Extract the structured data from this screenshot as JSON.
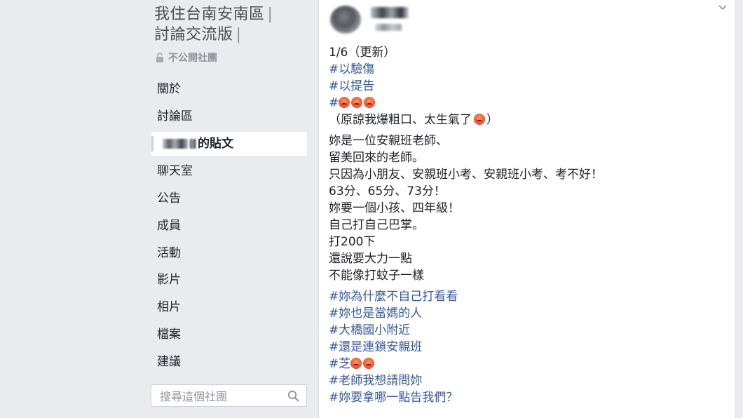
{
  "group": {
    "title_line1": "我住台南安南區",
    "title_line2": "討論交流版",
    "separator": "|",
    "privacy": "不公開社團"
  },
  "nav": {
    "items": [
      {
        "label": "關於"
      },
      {
        "label": "討論區"
      },
      {
        "label": "的貼文",
        "active": true
      },
      {
        "label": "聊天室"
      },
      {
        "label": "公告"
      },
      {
        "label": "成員"
      },
      {
        "label": "活動"
      },
      {
        "label": "影片"
      },
      {
        "label": "相片"
      },
      {
        "label": "檔案"
      },
      {
        "label": "建議"
      }
    ]
  },
  "search": {
    "placeholder": "搜尋這個社團"
  },
  "post": {
    "update_line": "1/6（更新）",
    "tags_top": [
      "#以驗傷",
      "#以提告"
    ],
    "emoji_tag_prefix": "#",
    "apology": "（原諒我爆粗口、太生氣了",
    "apology_end": "）",
    "body_lines": [
      "妳是一位安親班老師、",
      "留美回來的老師。",
      "只因為小朋友、安親班小考、安親班小考、考不好！",
      "63分、65分、73分！",
      "妳要一個小孩、四年級！",
      "自己打自己巴掌。",
      "打200下",
      "還說要大力一點",
      "不能像打蚊子一樣"
    ],
    "tags_bottom": [
      "#妳為什麼不自己打看看",
      "#妳也是當媽的人",
      "#大橋國小附近",
      "#還是連鎖安親班"
    ],
    "tag_zhi": "#芝",
    "tags_final": [
      "#老師我想請問妳",
      "#妳要拿哪一點告我們？"
    ]
  },
  "icons": {
    "lock": "lock-icon",
    "search": "search-icon",
    "options": "chevron-down-icon",
    "emoji": "angry-face-emoji"
  },
  "colors": {
    "link": "#365899",
    "sidebar_bg": "#e9ebee",
    "text": "#1d2129",
    "muted": "#90949c"
  }
}
